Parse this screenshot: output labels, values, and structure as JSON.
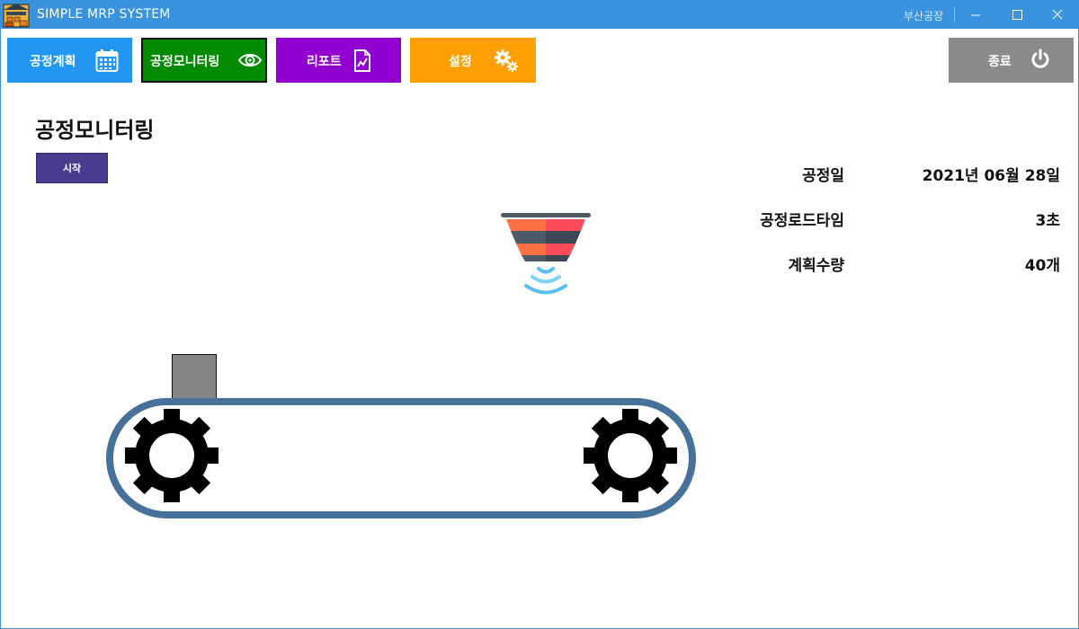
{
  "window": {
    "title": "SIMPLE MRP SYSTEM",
    "factory_name": "부산공장"
  },
  "nav": {
    "plan_label": "공정계획",
    "monitor_label": "공정모니터링",
    "report_label": "리포트",
    "settings_label": "설정",
    "exit_label": "종료"
  },
  "page": {
    "title": "공정모니터링",
    "start_button": "시작"
  },
  "info": {
    "date_label": "공정일",
    "date_value": "2021년 06월 28일",
    "load_time_label": "공정로드타임",
    "load_time_value": "3초",
    "quantity_label": "계획수량",
    "quantity_value": "40개"
  },
  "colors": {
    "titlebar": "#3a93de",
    "plan": "#2196f3",
    "monitor": "#028a00",
    "report": "#9200cf",
    "settings": "#ffa000",
    "exit": "#8a8a8a",
    "start": "#4b3b8f",
    "belt": "#46719a"
  },
  "icons": [
    "app-factory-icon",
    "calendar-icon",
    "eye-icon",
    "report-chart-icon",
    "gears-icon",
    "power-icon",
    "sensor-funnel-icon",
    "gear-icon"
  ]
}
